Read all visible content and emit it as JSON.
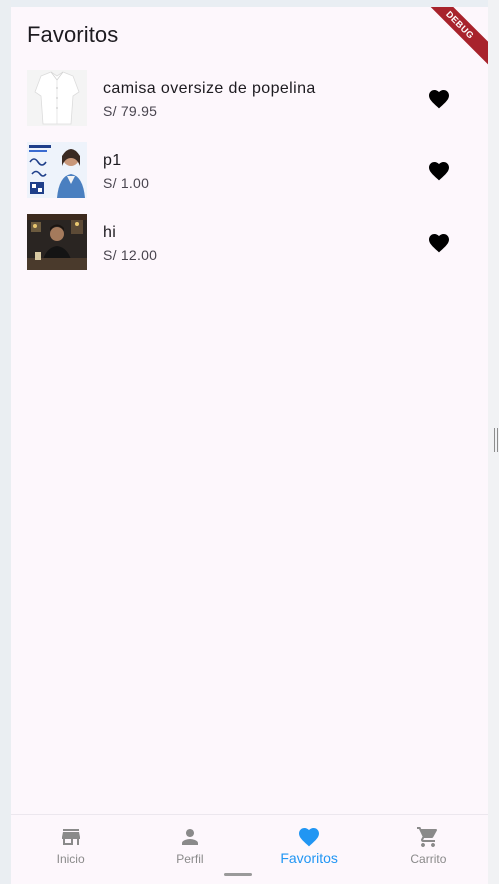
{
  "appbar": {
    "title": "Favoritos",
    "debug_banner": "DEBUG"
  },
  "favorites": [
    {
      "name": "camisa oversize de popelina",
      "price": "S/ 79.95",
      "thumb_icon": "white-shirt-photo"
    },
    {
      "name": "p1",
      "price": "S/ 1.00",
      "thumb_icon": "volunteer-poster-photo"
    },
    {
      "name": "hi",
      "price": "S/ 12.00",
      "thumb_icon": "person-photo"
    }
  ],
  "bottom_nav": {
    "items": [
      {
        "label": "Inicio",
        "icon": "store-icon"
      },
      {
        "label": "Perfil",
        "icon": "person-icon"
      },
      {
        "label": "Favoritos",
        "icon": "heart-icon"
      },
      {
        "label": "Carrito",
        "icon": "cart-icon"
      }
    ],
    "active_index": 2
  },
  "colors": {
    "accent": "#2196f3",
    "inactive": "#8a8a8a",
    "background": "#fdf7fc",
    "heart": "#000000",
    "debug": "#a8232c"
  }
}
